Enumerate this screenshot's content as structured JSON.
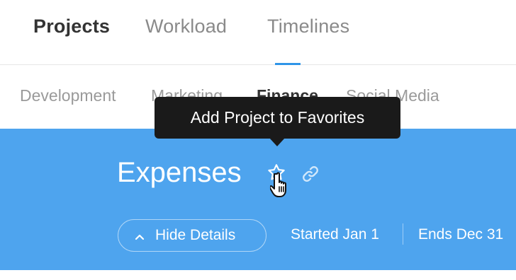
{
  "top_tabs": [
    {
      "label": "Projects",
      "active": true
    },
    {
      "label": "Workload",
      "active": false
    },
    {
      "label": "Timelines",
      "active": false
    }
  ],
  "sub_tabs": [
    {
      "label": "Development",
      "active": false
    },
    {
      "label": "Marketing",
      "active": false
    },
    {
      "label": "Finance",
      "active": true
    },
    {
      "label": "Social Media",
      "active": false
    }
  ],
  "tooltip": {
    "text": "Add Project to Favorites"
  },
  "project": {
    "title": "Expenses",
    "hide_details_label": "Hide Details",
    "started": "Started Jan 1",
    "ends": "Ends Dec 31"
  },
  "icons": {
    "favorite": "star-outline-icon",
    "link": "chain-link-icon",
    "collapse": "chevron-up-icon",
    "pointer": "hand-pointer-icon"
  },
  "colors": {
    "accent": "#2f95e8",
    "banner": "#4ea4ee",
    "tooltip_bg": "#1a1a1a"
  }
}
